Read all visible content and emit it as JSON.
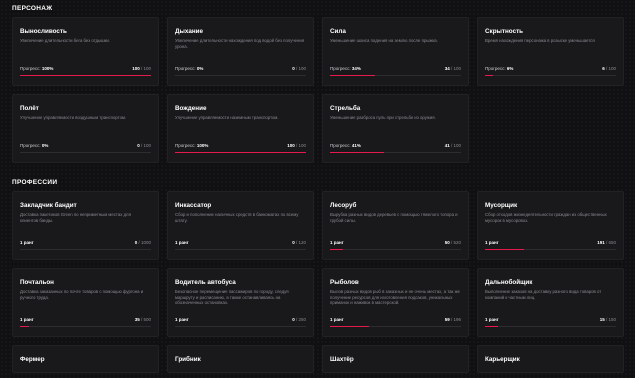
{
  "sections": {
    "skills_title": "ПЕРСОНАЖ",
    "professions_title": "ПРОФЕССИИ"
  },
  "colors": {
    "accent": "#e5194c",
    "card_bg": "#19191c",
    "page_bg": "#101012"
  },
  "skills": [
    {
      "title": "Выносливость",
      "desc": "Увеличение длительности бега без отдышки.",
      "progress_label": "Прогресс:",
      "percent": "100%",
      "value": "100",
      "max": "/ 100",
      "fill": 1.0
    },
    {
      "title": "Дыхание",
      "desc": "Увеличение длительности нахождения под водой без получения урона.",
      "progress_label": "Прогресс:",
      "percent": "0%",
      "value": "0",
      "max": "/ 100",
      "fill": 0.0
    },
    {
      "title": "Сила",
      "desc": "Уменьшение шанса падения на землю после прыжка.",
      "progress_label": "Прогресс:",
      "percent": "34%",
      "value": "34",
      "max": "/ 100",
      "fill": 0.34
    },
    {
      "title": "Скрытность",
      "desc": "Время нахождения персонажа в розыске уменьшается",
      "progress_label": "Прогресс:",
      "percent": "6%",
      "value": "6",
      "max": "/ 100",
      "fill": 0.06
    },
    {
      "title": "Полёт",
      "desc": "Улучшение управляемости воздушным транспортом.",
      "progress_label": "Прогресс:",
      "percent": "0%",
      "value": "0",
      "max": "/ 100",
      "fill": 0.0
    },
    {
      "title": "Вождение",
      "desc": "Улучшение управляемости наземным транспортом.",
      "progress_label": "Прогресс:",
      "percent": "100%",
      "value": "100",
      "max": "/ 100",
      "fill": 1.0
    },
    {
      "title": "Стрельба",
      "desc": "Уменьшение разброса пуль при стрельбе из оружия.",
      "progress_label": "Прогресс:",
      "percent": "41%",
      "value": "41",
      "max": "/ 100",
      "fill": 0.41
    }
  ],
  "professions": [
    {
      "title": "Закладчик бандит",
      "desc": "Доставка пакетиков Green по неприметным местах для клиентов банды.",
      "rank": "1 ранг",
      "value": "0",
      "max": "/ 1000",
      "fill": 0.0
    },
    {
      "title": "Инкассатор",
      "desc": "Сбор и пополнение наличных средств в банкоматах по всему штату.",
      "rank": "1 ранг",
      "value": "0",
      "max": "/ 120",
      "fill": 0.0
    },
    {
      "title": "Лесоруб",
      "desc": "Вырубка разных видов деревьев с помощью тяжелого топора и грубой силы.",
      "rank": "1 ранг",
      "value": "50",
      "max": "/ 520",
      "fill": 0.096
    },
    {
      "title": "Мусорщик",
      "desc": "Сбор отходов жизнедеятельности граждан из общественных мусорок в мусоровоз.",
      "rank": "1 ранг",
      "value": "191",
      "max": "/ 650",
      "fill": 0.294
    },
    {
      "title": "Почтальон",
      "desc": "Доставка заказанных по почте товаров с помощью фургона и ручного труда.",
      "rank": "1 ранг",
      "value": "35",
      "max": "/ 500",
      "fill": 0.07
    },
    {
      "title": "Водитель автобуса",
      "desc": "Безопасное перемещение пассажиров по городу, следуя маршруту и расписанию, а также останавливаясь на обозначенных остановках.",
      "rank": "1 ранг",
      "value": "0",
      "max": "/ 250",
      "fill": 0.0
    },
    {
      "title": "Рыболов",
      "desc": "Вылов разных видов рыб в заказных и не очень местах, а так же получение ресурсов для изготовления подсаков, уникальных приманок и наживок в мастерской.",
      "rank": "1 ранг",
      "value": "59",
      "max": "/ 196",
      "fill": 0.301
    },
    {
      "title": "Дальнобойщик",
      "desc": "Выполнение заказов на доставку разного вида товаров от компаний к частным лиц.",
      "rank": "1 ранг",
      "value": "15",
      "max": "/ 150",
      "fill": 0.1
    },
    {
      "title": "Фермер"
    },
    {
      "title": "Грибник"
    },
    {
      "title": "Шахтёр"
    },
    {
      "title": "Карьерщик"
    }
  ]
}
